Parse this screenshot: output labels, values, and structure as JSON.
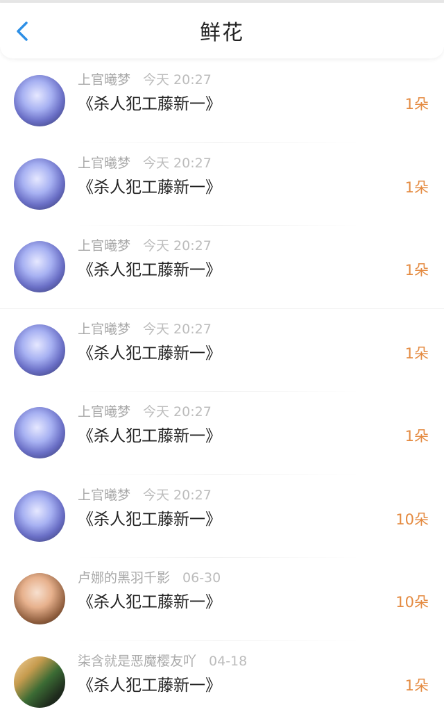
{
  "header": {
    "title": "鲜花"
  },
  "items": [
    {
      "name": "上官曦梦",
      "time": "今天  20:27",
      "text": "《杀人犯工藤新一》",
      "count": "1朵",
      "avatar": "purple"
    },
    {
      "name": "上官曦梦",
      "time": "今天  20:27",
      "text": "《杀人犯工藤新一》",
      "count": "1朵",
      "avatar": "purple"
    },
    {
      "name": "上官曦梦",
      "time": "今天  20:27",
      "text": "《杀人犯工藤新一》",
      "count": "1朵",
      "avatar": "purple"
    },
    {
      "name": "上官曦梦",
      "time": "今天  20:27",
      "text": "《杀人犯工藤新一》",
      "count": "1朵",
      "avatar": "purple"
    },
    {
      "name": "上官曦梦",
      "time": "今天  20:27",
      "text": "《杀人犯工藤新一》",
      "count": "1朵",
      "avatar": "purple"
    },
    {
      "name": "上官曦梦",
      "time": "今天  20:27",
      "text": "《杀人犯工藤新一》",
      "count": "10朵",
      "avatar": "purple"
    },
    {
      "name": "卢娜的黑羽千影",
      "time": "06-30",
      "text": "《杀人犯工藤新一》",
      "count": "10朵",
      "avatar": "orange"
    },
    {
      "name": "柒含就是恶魔樱友吖",
      "time": "04-18",
      "text": "《杀人犯工藤新一》",
      "count": "1朵",
      "avatar": "mix"
    }
  ]
}
